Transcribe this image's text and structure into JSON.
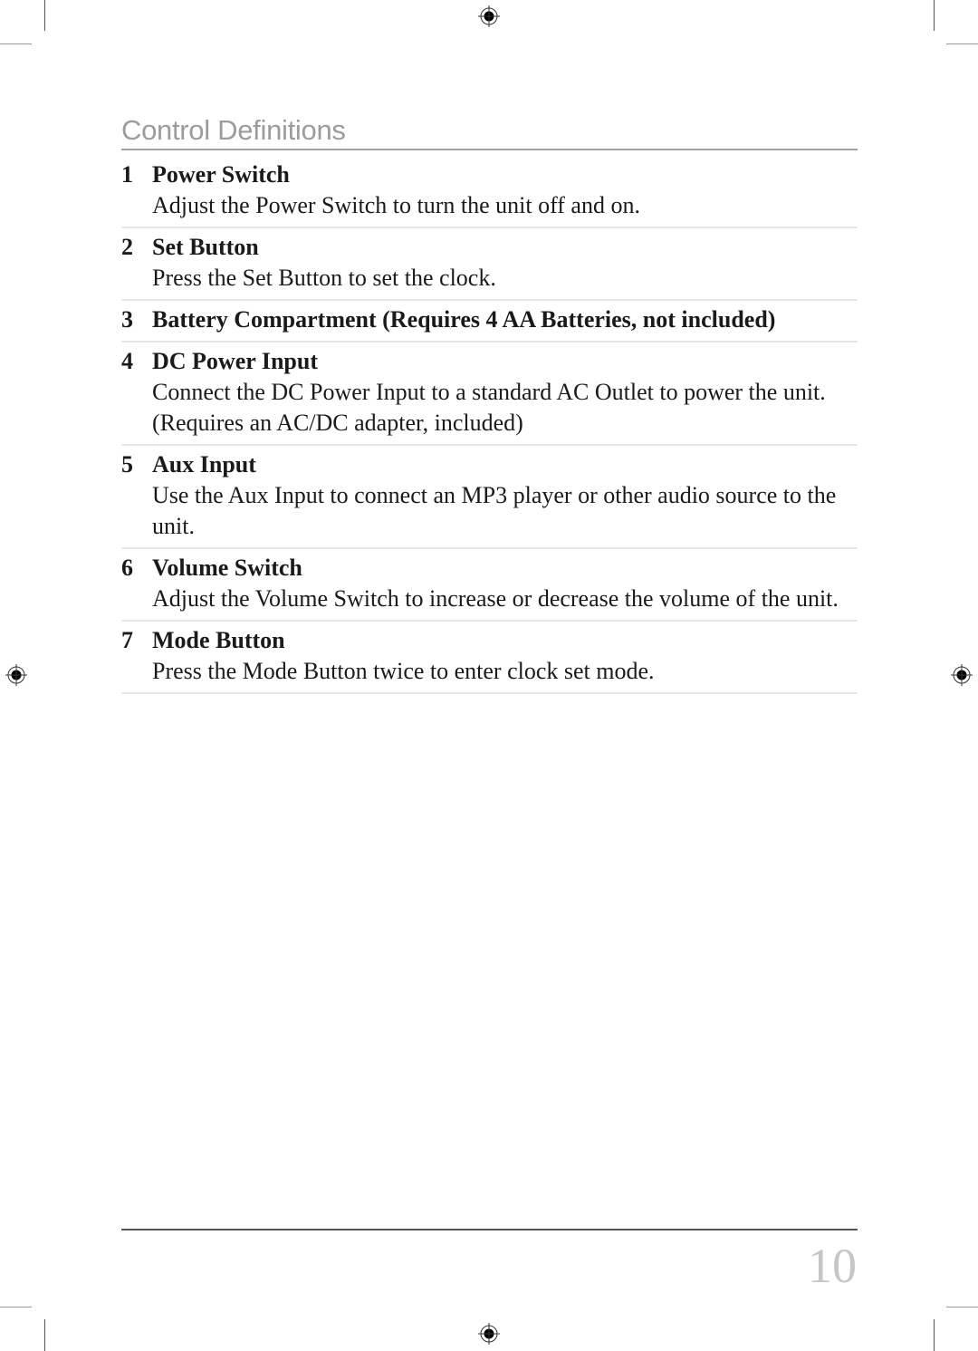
{
  "page": {
    "section_title": "Control Definitions",
    "page_number": "10"
  },
  "items": [
    {
      "num": "1",
      "title": "Power Switch",
      "desc": "Adjust the Power Switch to turn the unit off and on."
    },
    {
      "num": "2",
      "title": "Set Button",
      "desc": "Press the Set Button to set the clock."
    },
    {
      "num": "3",
      "title": "Battery Compartment (Requires 4 AA Batteries, not included)",
      "desc": ""
    },
    {
      "num": "4",
      "title": "DC Power Input",
      "desc": "Connect the DC Power Input to a standard AC Outlet to power the unit. (Requires an AC/DC adapter, included)"
    },
    {
      "num": "5",
      "title": "Aux Input",
      "desc": "Use the Aux Input to connect an MP3 player or other audio source to the unit."
    },
    {
      "num": "6",
      "title": "Volume Switch",
      "desc": "Adjust the Volume Switch to increase or decrease the volume of the unit."
    },
    {
      "num": "7",
      "title": "Mode Button",
      "desc": "Press the Mode Button twice to enter clock set mode."
    }
  ],
  "icons": {
    "registration_mark": "registration-mark-icon",
    "crop_mark": "crop-mark"
  }
}
